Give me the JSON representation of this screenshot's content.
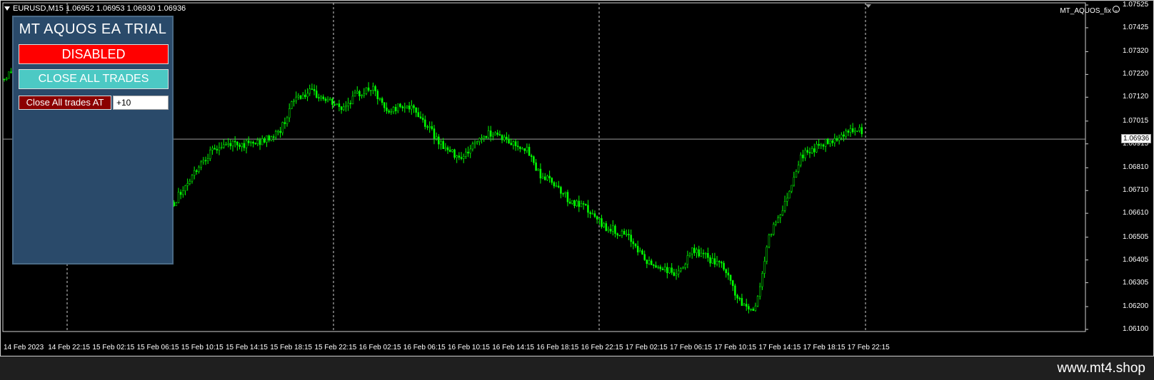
{
  "chart": {
    "header": "EURUSD,M15  1.06952 1.06953 1.06930 1.06936",
    "indicator_name": "MT_AQUOS_fix",
    "current_price": "1.06936",
    "price_levels": [
      "1.07525",
      "1.07425",
      "1.07320",
      "1.07220",
      "1.07120",
      "1.07015",
      "1.06915",
      "1.06810",
      "1.06710",
      "1.06610",
      "1.06505",
      "1.06405",
      "1.06305",
      "1.06200",
      "1.06100"
    ],
    "date_labels": [
      "14 Feb 2023",
      "14 Feb 22:15",
      "15 Feb 02:15",
      "15 Feb 06:15",
      "15 Feb 10:15",
      "15 Feb 14:15",
      "15 Feb 18:15",
      "15 Feb 22:15",
      "16 Feb 02:15",
      "16 Feb 06:15",
      "16 Feb 10:15",
      "16 Feb 14:15",
      "16 Feb 18:15",
      "16 Feb 22:15",
      "17 Feb 02:15",
      "17 Feb 06:15",
      "17 Feb 10:15",
      "17 Feb 14:15",
      "17 Feb 18:15",
      "17 Feb 22:15"
    ],
    "candle_color": "#00ff00",
    "background_color": "#000000",
    "price_path": [
      1.072,
      1.0728,
      1.0733,
      1.0722,
      1.0712,
      1.07,
      1.0688,
      1.0675,
      1.067,
      1.0682,
      1.0672,
      1.0665,
      1.0675,
      1.0685,
      1.069,
      1.0692,
      1.0691,
      1.0693,
      1.0697,
      1.0712,
      1.0714,
      1.0711,
      1.0707,
      1.0713,
      1.0716,
      1.0705,
      1.0709,
      1.0705,
      1.0696,
      1.0688,
      1.0686,
      1.0694,
      1.0697,
      1.0692,
      1.069,
      1.0678,
      1.0674,
      1.0666,
      1.0663,
      1.0656,
      1.0653,
      1.0649,
      1.0639,
      1.0637,
      1.0634,
      1.0645,
      1.0641,
      1.0637,
      1.0622,
      1.0618,
      1.0652,
      1.0666,
      1.0686,
      1.069,
      1.0693,
      1.0697,
      1.0697
    ]
  },
  "panel": {
    "title": "MT  AQUOS EA TRIAL",
    "status_button": "DISABLED",
    "close_all_button": "CLOSE ALL TRADES",
    "close_at_button": "Close All trades AT",
    "close_at_value": "+10",
    "colors": {
      "background": "#2a4a6a",
      "disabled": "#ff0000",
      "close_all": "#4cc9c4",
      "close_at": "#8b0000"
    }
  },
  "footer": {
    "brand": "www.mt4.shop"
  }
}
